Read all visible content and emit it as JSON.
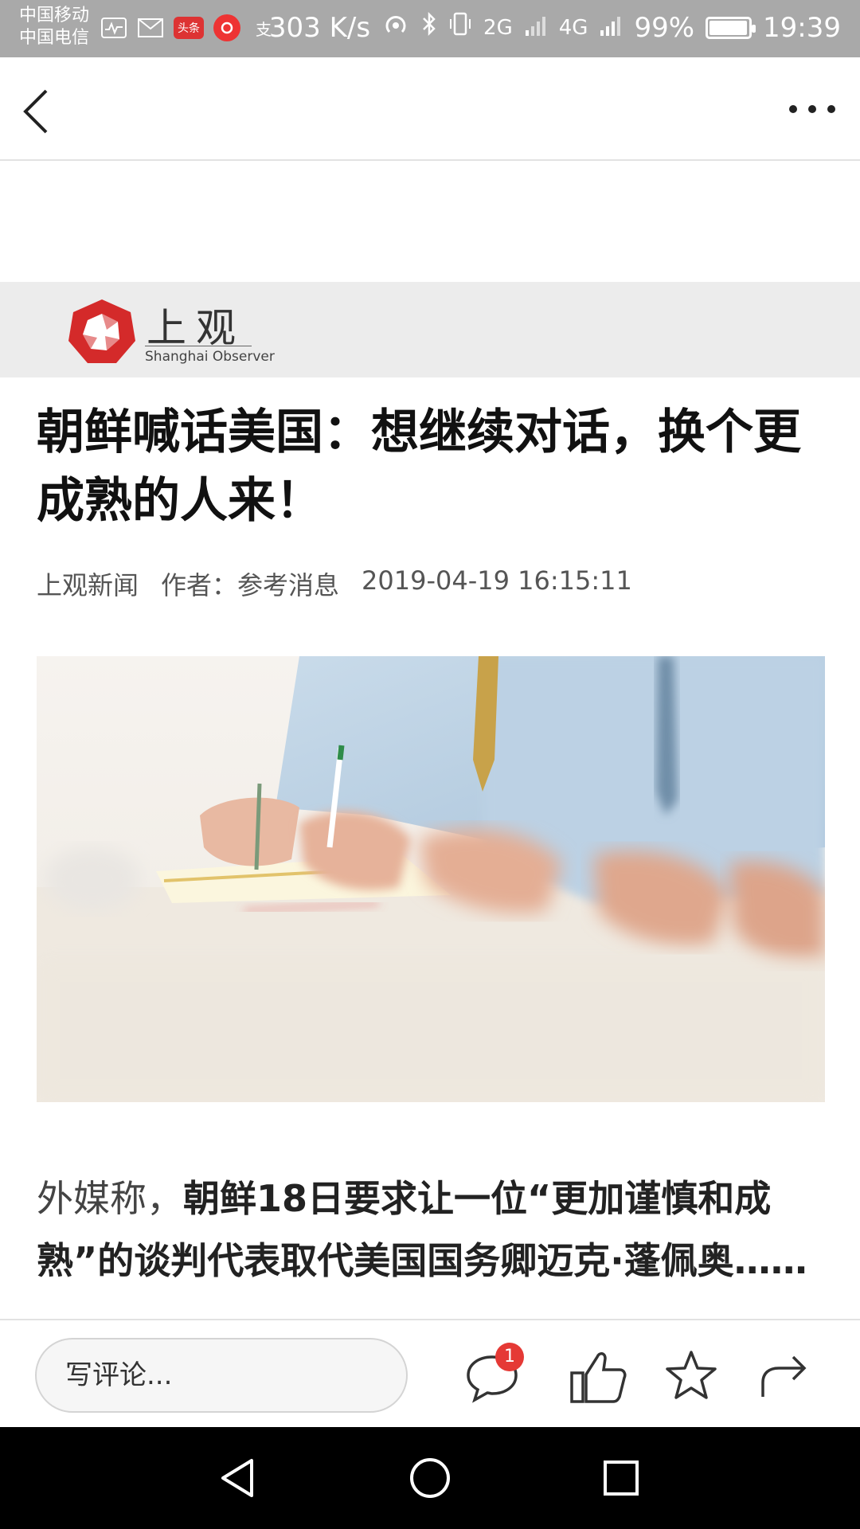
{
  "status_bar": {
    "carrier_1": "中国移动",
    "carrier_2": "中国电信",
    "speed": "303 K/s",
    "battery": "99%",
    "time": "19:39",
    "network_a": "2G",
    "network_b": "4G",
    "icons": [
      "activity-icon",
      "mail-icon",
      "toutiao-icon",
      "netease-music-icon",
      "alipay-icon",
      "hotspot-icon",
      "bluetooth-icon",
      "vibrate-icon",
      "signal-icon",
      "battery-icon"
    ]
  },
  "header": {
    "back_icon": "chevron-left-icon",
    "more_icon": "more-horizontal-icon"
  },
  "brand": {
    "name_cn": "上观",
    "name_en": "Shanghai Observer",
    "color": "#d42a2a"
  },
  "article": {
    "title": "朝鲜喊话美国：想继续对话，换个更成熟的人来！",
    "source": "上观新闻",
    "author": "作者：参考消息",
    "datetime": "2019-04-19 16:15:11",
    "body_lead": "外媒称，",
    "body_bold": "朝鲜18日要求让一位“更加谨慎和成熟”的谈判代表取代美国国务卿迈克·蓬佩奥……"
  },
  "action_bar": {
    "comment_placeholder": "写评论...",
    "comment_count": "1",
    "icons": [
      "comment-icon",
      "thumbs-up-icon",
      "star-icon",
      "share-icon"
    ]
  },
  "nav_bar": {
    "icons": [
      "nav-back-icon",
      "nav-home-icon",
      "nav-recents-icon"
    ]
  }
}
